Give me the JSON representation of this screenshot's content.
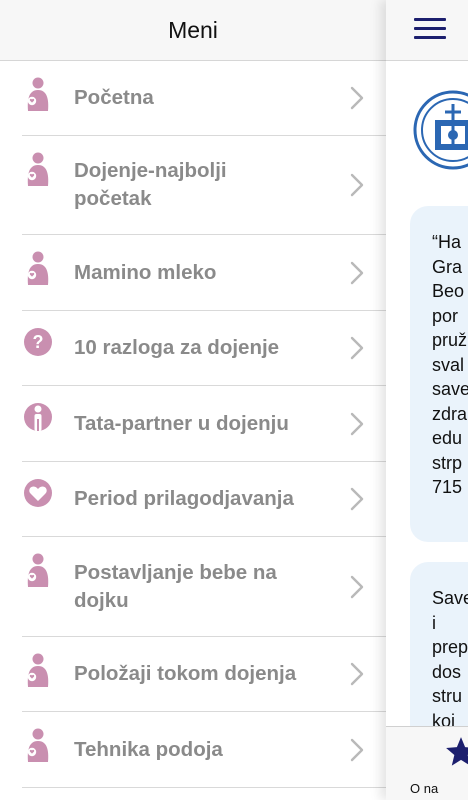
{
  "menu": {
    "title": "Meni",
    "items": [
      {
        "label": "Početna",
        "icon": "mother-baby-icon"
      },
      {
        "label": "Dojenje-najbolji\npočetak",
        "icon": "mother-baby-icon"
      },
      {
        "label": "Mamino mleko",
        "icon": "mother-baby-icon"
      },
      {
        "label": "10 razloga za dojenje",
        "icon": "question-icon"
      },
      {
        "label": "Tata-partner u dojenju",
        "icon": "father-icon"
      },
      {
        "label": "Period prilagodjavanja",
        "icon": "heart-icon"
      },
      {
        "label": "Postavljanje bebe na\ndojku",
        "icon": "mother-baby-icon"
      },
      {
        "label": "Položaji tokom dojenja",
        "icon": "mother-baby-icon"
      },
      {
        "label": "Tehnika podoja",
        "icon": "mother-baby-icon"
      }
    ]
  },
  "panel": {
    "card1_text": "“Ha\nGra\nBeo\npor\npruž\nsval\nsave\nzdra\nedu\nstrp\n715",
    "card2_text": "Save\ni\nprep\ndos\nstru\nkoj",
    "tab_label": "O na"
  },
  "colors": {
    "icon_pink": "#c98fb0",
    "accent_navy": "#1c1f6e",
    "card_bg": "#eaf3fb"
  }
}
